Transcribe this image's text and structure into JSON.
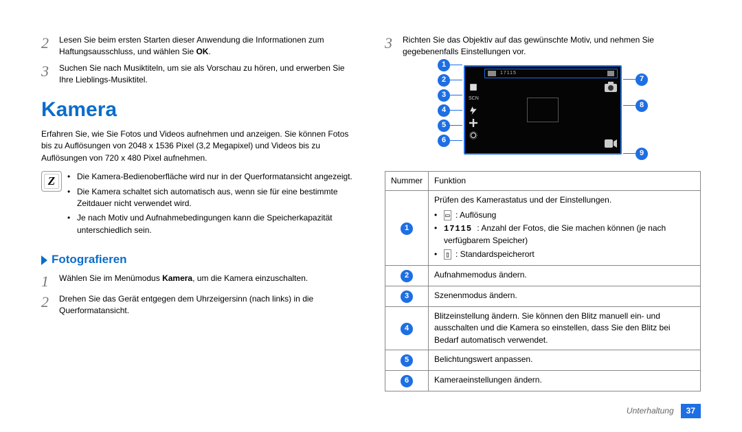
{
  "left": {
    "step2": "Lesen Sie beim ersten Starten dieser Anwendung die Informationen zum Haftungsausschluss, und wählen Sie ",
    "step2_bold": "OK",
    "step2_end": ".",
    "step3": "Suchen Sie nach Musiktiteln, um sie als Vorschau zu hören, und erwerben Sie Ihre Lieblings-Musiktitel.",
    "h1": "Kamera",
    "intro": "Erfahren Sie, wie Sie Fotos und Videos aufnehmen und anzeigen. Sie können Fotos bis zu Auflösungen von 2048 x 1536 Pixel (3,2 Megapixel) und Videos bis zu Auflösungen von 720 x 480 Pixel aufnehmen.",
    "note1": "Die Kamera-Bedienoberfläche wird nur in der Querformatansicht angezeigt.",
    "note2": "Die Kamera schaltet sich automatisch aus, wenn sie für eine bestimmte Zeitdauer nicht verwendet wird.",
    "note3": "Je nach Motiv und Aufnahmebedingungen kann die Speicherkapazität unterschiedlich sein.",
    "h2": "Fotografieren",
    "p1_a": "Wählen Sie im Menümodus ",
    "p1_bold": "Kamera",
    "p1_b": ", um die Kamera einzuschalten.",
    "p2": "Drehen Sie das Gerät entgegen dem Uhrzeigersinn (nach links) in die Querformatansicht."
  },
  "right": {
    "step3": "Richten Sie das Objektiv auf das gewünschte Motiv, und nehmen Sie gegebenenfalls Einstellungen vor.",
    "th_num": "Nummer",
    "th_fn": "Funktion",
    "row1_top": "Prüfen des Kamerastatus und der Einstellungen.",
    "row1_a": " : Auflösung",
    "row1_b": " : Anzahl der Fotos, die Sie machen können (je nach verfügbarem Speicher)",
    "row1_b_lead": "17115",
    "row1_c": " : Standardspeicherort",
    "row2": "Aufnahmemodus ändern.",
    "row3": "Szenenmodus ändern.",
    "row4": "Blitzeinstellung ändern. Sie können den Blitz manuell ein- und ausschalten und die Kamera so einstellen, dass Sie den Blitz bei Bedarf automatisch verwendet.",
    "row5": "Belichtungswert anpassen.",
    "row6": "Kameraeinstellungen ändern."
  },
  "callouts_left": [
    "1",
    "2",
    "3",
    "4",
    "5",
    "6"
  ],
  "callouts_right": [
    "7",
    "8",
    "9"
  ],
  "footer": {
    "section": "Unterhaltung",
    "page": "37"
  },
  "note_glyph": "Z"
}
